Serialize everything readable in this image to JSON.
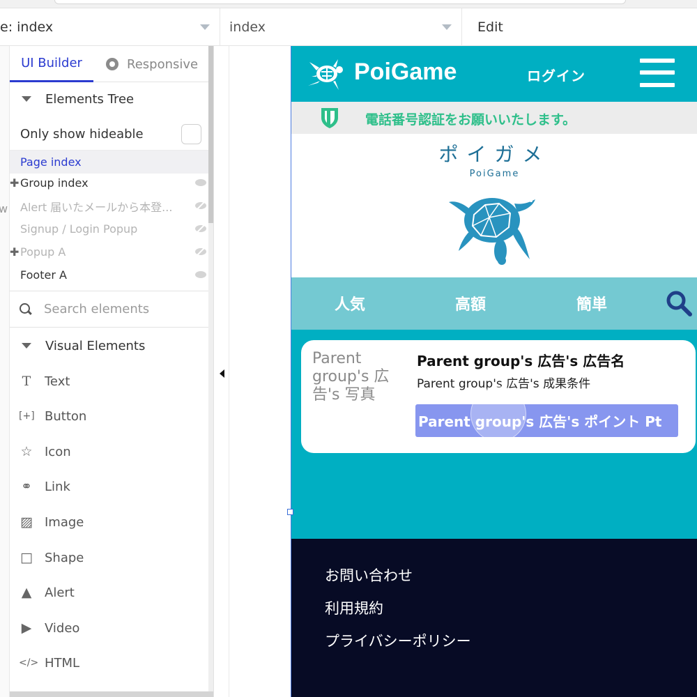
{
  "toolbar": {
    "page_selector": "e: index",
    "element_selector": "index",
    "mode": "Edit"
  },
  "sidebar": {
    "sliver_char": "w",
    "tabs": [
      {
        "label": "UI Builder",
        "active": true
      },
      {
        "label": "Responsive",
        "icon": "responsive-icon"
      }
    ],
    "elements_tree": {
      "heading": "Elements Tree",
      "only_show_hideable": "Only show hideable",
      "items": [
        {
          "label": "Page index",
          "selected": true
        },
        {
          "label": "Group index",
          "expandable": true
        },
        {
          "label": "Alert 届いたメールから本登...",
          "hidden": true
        },
        {
          "label": "Signup / Login Popup",
          "hidden": true
        },
        {
          "label": "Popup A",
          "expandable": true,
          "hidden": true
        },
        {
          "label": "Footer A"
        }
      ]
    },
    "search_placeholder": "Search elements",
    "visual_elements": {
      "heading": "Visual Elements",
      "items": [
        {
          "label": "Text",
          "icon": "text-icon"
        },
        {
          "label": "Button",
          "icon": "button-icon"
        },
        {
          "label": "Icon",
          "icon": "star-icon"
        },
        {
          "label": "Link",
          "icon": "link-icon"
        },
        {
          "label": "Image",
          "icon": "image-icon"
        },
        {
          "label": "Shape",
          "icon": "shape-icon"
        },
        {
          "label": "Alert",
          "icon": "alert-icon"
        },
        {
          "label": "Video",
          "icon": "video-icon"
        },
        {
          "label": "HTML",
          "icon": "html-icon"
        }
      ]
    }
  },
  "site": {
    "brand": "PoiGame",
    "login": "ログイン",
    "notice": "電話番号認証をお願いいたします。",
    "hero_jp": "ポイガメ",
    "hero_en": "PoiGame",
    "categories": [
      "人気",
      "高額",
      "簡単"
    ],
    "card": {
      "photo_label": "Parent group's 広告's 写真",
      "name": "Parent group's 広告's 広告名",
      "condition": "Parent group's 広告's 成果条件",
      "points_button": "Parent group's 広告's ポイント Pt"
    },
    "footer_links": [
      "お問い合わせ",
      "利用規約",
      "プライバシーポリシー"
    ],
    "colors": {
      "accent": "#2b3bd0",
      "header_teal": "#00afc2",
      "nav_teal": "#74c9d2",
      "notice_green": "#2ebf8a",
      "button_blue": "#8796ef",
      "footer_navy": "#070b25"
    }
  }
}
